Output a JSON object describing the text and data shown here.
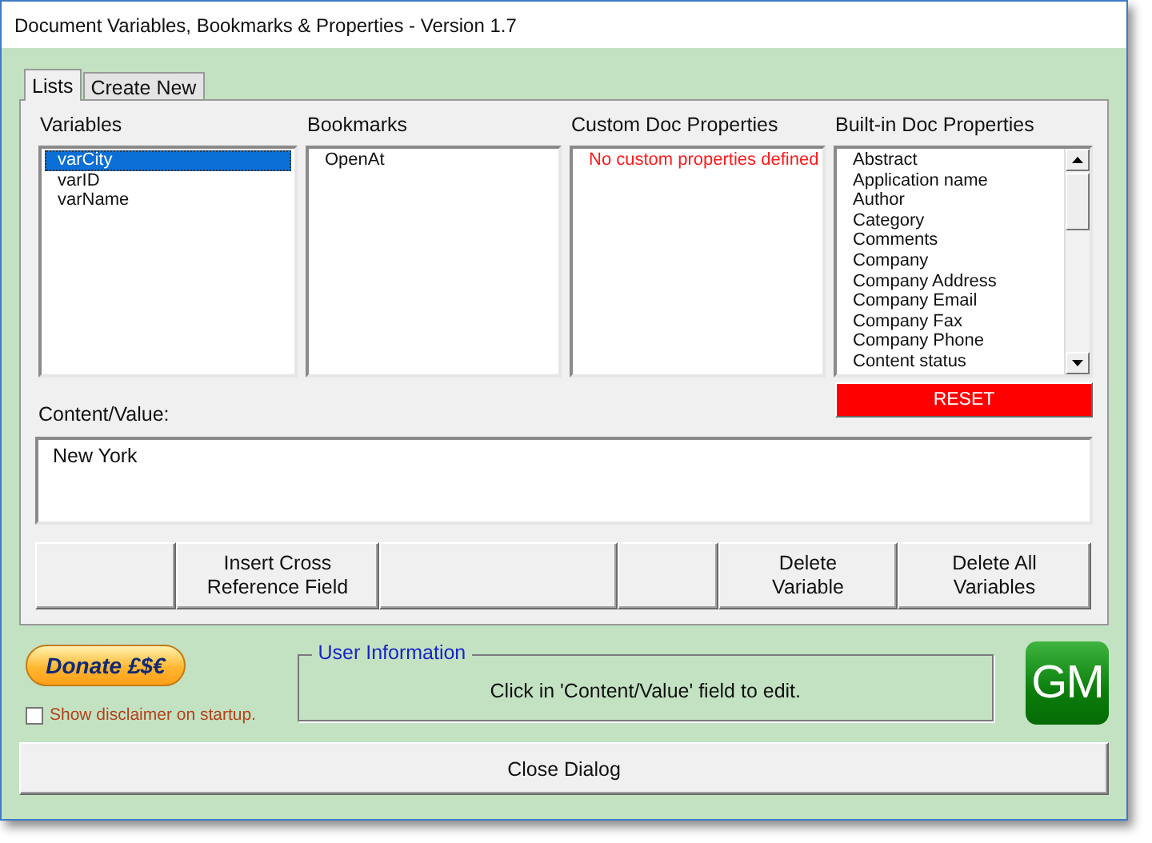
{
  "window": {
    "title": "Document Variables, Bookmarks & Properties - Version 1.7"
  },
  "tabs": [
    {
      "label": "Lists",
      "selected": true
    },
    {
      "label": "Create New",
      "selected": false
    }
  ],
  "lists": [
    {
      "heading": "Variables",
      "items": [
        {
          "label": "varCity",
          "selected": true
        },
        {
          "label": "varID",
          "selected": false
        },
        {
          "label": "varName",
          "selected": false
        }
      ]
    },
    {
      "heading": "Bookmarks",
      "items": [
        {
          "label": "OpenAt",
          "selected": false
        }
      ]
    },
    {
      "heading": "Custom Doc Properties",
      "message": "No custom properties defined"
    },
    {
      "heading": "Built-in Doc Properties",
      "scrollbar": true,
      "items": [
        {
          "label": "Abstract",
          "selected": false
        },
        {
          "label": "Application name",
          "selected": false
        },
        {
          "label": "Author",
          "selected": false
        },
        {
          "label": "Category",
          "selected": false
        },
        {
          "label": "Comments",
          "selected": false
        },
        {
          "label": "Company",
          "selected": false
        },
        {
          "label": "Company Address",
          "selected": false
        },
        {
          "label": "Company Email",
          "selected": false
        },
        {
          "label": "Company Fax",
          "selected": false
        },
        {
          "label": "Company Phone",
          "selected": false
        },
        {
          "label": "Content status",
          "selected": false
        }
      ]
    }
  ],
  "reset_button": "RESET",
  "content": {
    "label": "Content/Value:",
    "value": "New York"
  },
  "action_buttons": [
    {
      "kind": "blank"
    },
    {
      "kind": "labeled",
      "label": "Insert Cross Reference Field"
    },
    {
      "kind": "blank"
    },
    {
      "kind": "blank"
    },
    {
      "kind": "labeled",
      "label": "Delete Variable"
    },
    {
      "kind": "labeled",
      "label": "Delete All Variables"
    }
  ],
  "donate_button": "Donate £$€",
  "disclaimer": {
    "label": "Show disclaimer on startup.",
    "checked": false
  },
  "user_information": {
    "title": "User Information",
    "message": "Click in 'Content/Value' field to edit."
  },
  "logo": "GM",
  "close_button": "Close Dialog"
}
